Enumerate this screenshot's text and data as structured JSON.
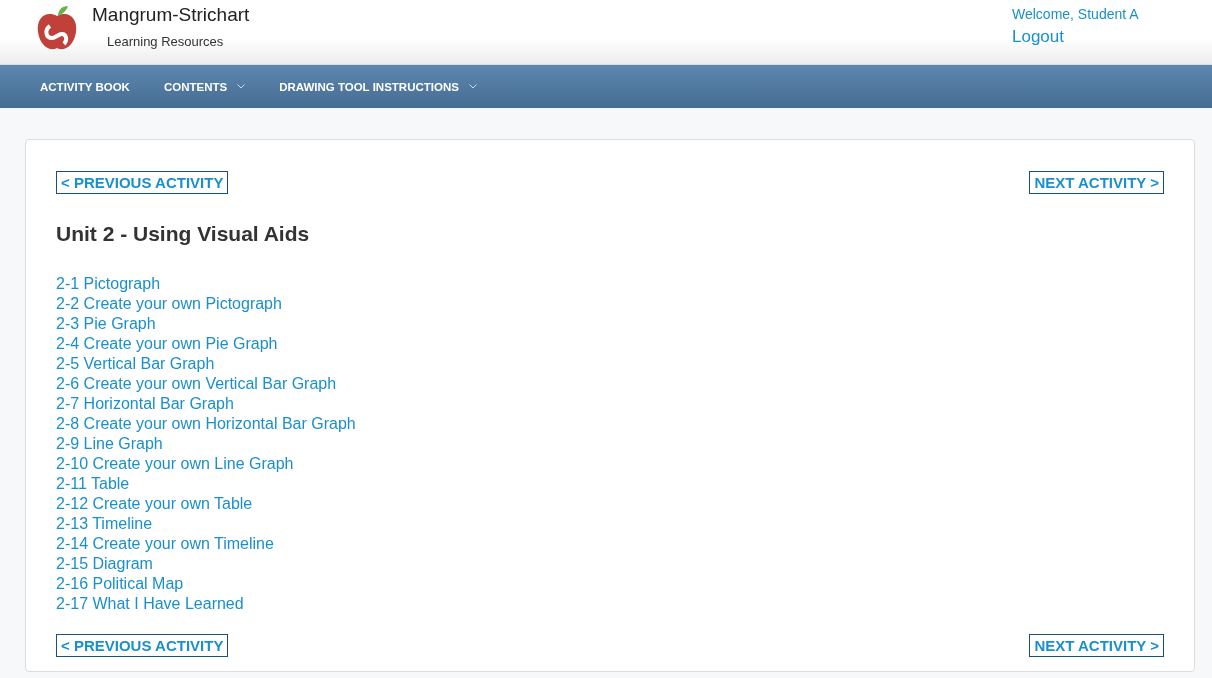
{
  "header": {
    "brand": "Mangrum-Strichart",
    "tagline": "Learning Resources",
    "welcome": "Welcome, Student A",
    "logout": "Logout"
  },
  "nav": [
    {
      "label": "ACTIVITY BOOK",
      "has_menu": false
    },
    {
      "label": "CONTENTS",
      "has_menu": true
    },
    {
      "label": "DRAWING TOOL INSTRUCTIONS",
      "has_menu": true
    }
  ],
  "pager_top": {
    "previous": "< PREVIOUS ACTIVITY",
    "next": "NEXT ACTIVITY >"
  },
  "title": "Unit 2 - Using Visual Aids",
  "activities": [
    "2-1 Pictograph",
    "2-2 Create your own Pictograph",
    "2-3 Pie Graph",
    "2-4 Create your own Pie Graph",
    "2-5 Vertical Bar Graph",
    "2-6 Create your own Vertical Bar Graph",
    "2-7 Horizontal Bar Graph",
    "2-8 Create your own Horizontal Bar Graph",
    "2-9 Line Graph",
    "2-10 Create your own Line Graph",
    "2-11 Table",
    "2-12 Create your own Table",
    "2-13 Timeline",
    "2-14 Create your own Timeline",
    "2-15 Diagram",
    "2-16 Political Map",
    "2-17 What I Have Learned"
  ],
  "pager_bottom": {
    "previous": "< PREVIOUS ACTIVITY",
    "next": "NEXT ACTIVITY >"
  }
}
